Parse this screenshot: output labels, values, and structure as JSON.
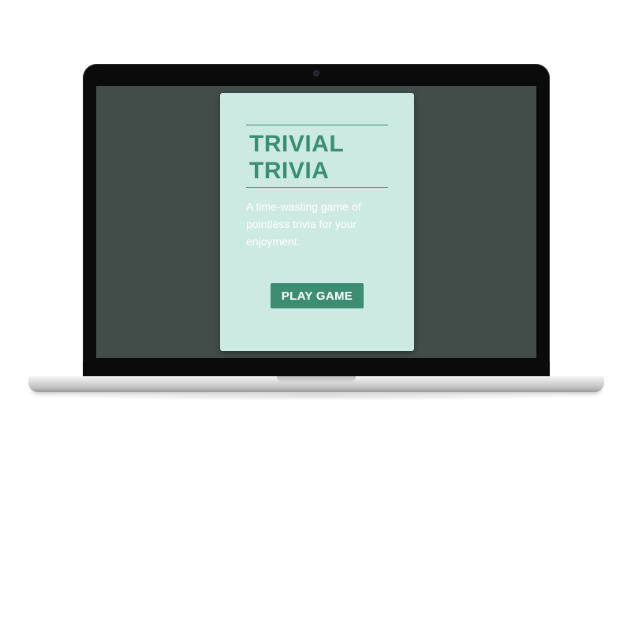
{
  "game": {
    "title_line1": "TRIVIAL",
    "title_line2": "TRIVIA",
    "tagline": "A time-wasting game of pointless trivia for your enjoyment.",
    "play_label": "PLAY GAME"
  },
  "colors": {
    "screen_background": "#424d4a",
    "card_background": "#cde9e4",
    "accent": "#3d8d73",
    "title_text": "#3a8f72",
    "tagline_text": "#ffffff"
  },
  "device": {
    "type": "laptop",
    "icons": [
      "camera-icon"
    ]
  }
}
